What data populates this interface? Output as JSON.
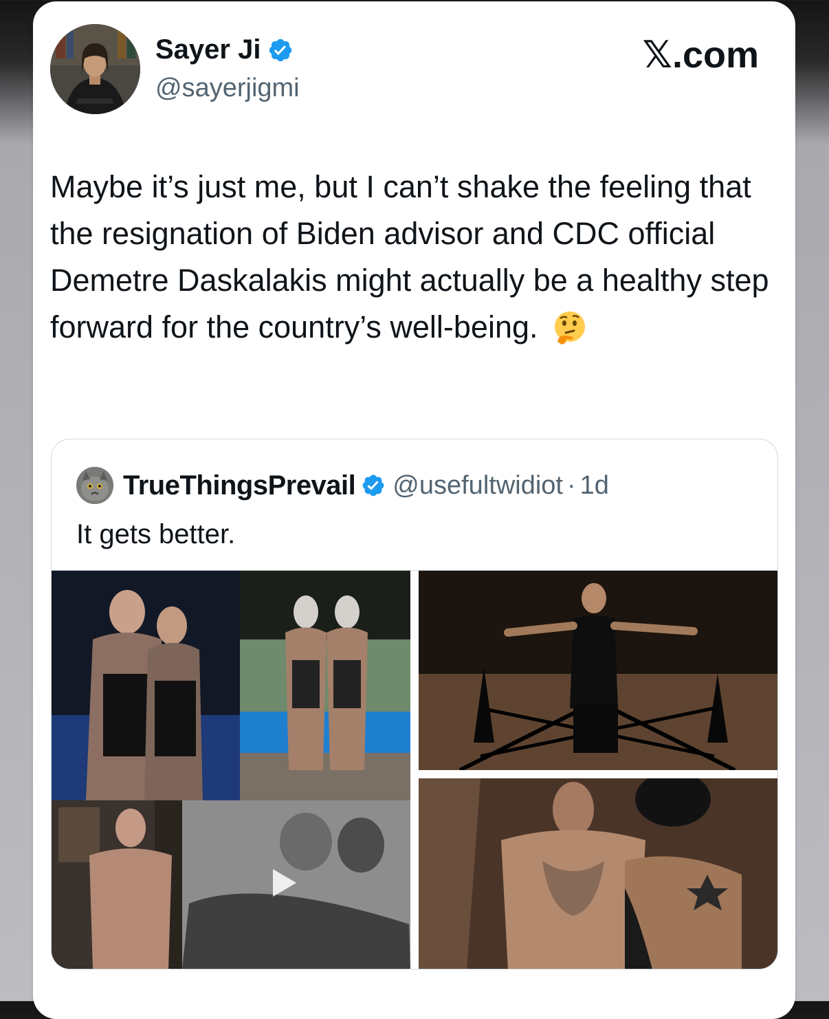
{
  "author": {
    "name": "Sayer Ji",
    "handle": "@sayerjigmi",
    "verified": true,
    "avatar_icon": "profile-photo"
  },
  "brand": "𝕏.com",
  "tweet": {
    "text": "Maybe it’s just me, but I can’t shake the feeling that the resignation of Biden advisor and CDC official Demetre Daskalakis might actually be a healthy step forward for the country’s well-being.",
    "emoji": "thinking-face-emoji"
  },
  "quoted_tweet": {
    "name": "TrueThingsPrevail",
    "handle": "@usefultwidiot",
    "separator": "·",
    "time": "1d",
    "verified": true,
    "text": "It gets better.",
    "media_count": 4,
    "has_video": true
  },
  "colors": {
    "text_primary": "#0f1419",
    "text_secondary": "#536471",
    "verified_blue": "#1d9bf0",
    "border": "#cfd9de"
  }
}
